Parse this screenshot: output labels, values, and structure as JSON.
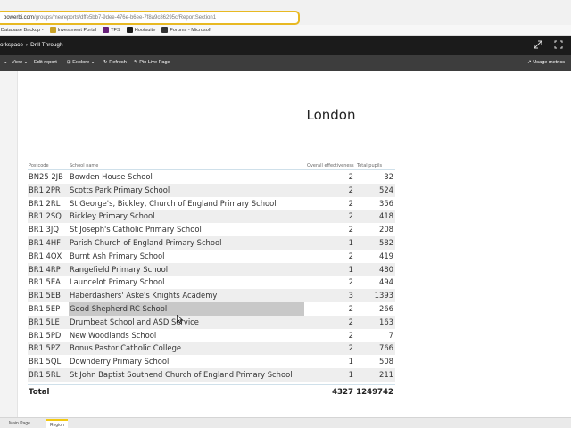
{
  "browser": {
    "url_host": "powerbi.com",
    "url_path": "/groups/me/reports/dffe5bb7-9dee-476e-b6ee-7f8a9c86295c/ReportSection1",
    "bookmarks": [
      {
        "label": "Database Backup -",
        "icon": "database-icon",
        "color": "#3b78d8"
      },
      {
        "label": "Investment Portal",
        "icon": "portal-icon",
        "color": "#c9a227"
      },
      {
        "label": "TFS",
        "icon": "tfs-icon",
        "color": "#68217a"
      },
      {
        "label": "Hootsuite",
        "icon": "hootsuite-icon",
        "color": "#1a1a1a"
      },
      {
        "label": "Forums - Microsoft",
        "icon": "forums-icon",
        "color": "#333333"
      }
    ]
  },
  "header": {
    "workspace": "orkspace",
    "breadcrumb_sep": "›",
    "page": "Drill Through"
  },
  "toolbar": {
    "view": "View ⌄",
    "edit_report": "Edit report",
    "explore": "Explore ⌄",
    "refresh": "Refresh",
    "pin_live": "Pin Live Page",
    "usage": "Usage metrics"
  },
  "report": {
    "title": "London",
    "columns": {
      "postcode": "Postcode",
      "school": "School name",
      "effectiveness": "Overall effectiveness",
      "pupils": "Total pupils"
    },
    "rows": [
      {
        "postcode": "BN25 2JB",
        "school": "Bowden House School",
        "eff": "2",
        "pupils": "32"
      },
      {
        "postcode": "BR1 2PR",
        "school": "Scotts Park Primary School",
        "eff": "2",
        "pupils": "524"
      },
      {
        "postcode": "BR1 2RL",
        "school": "St George's, Bickley, Church of England Primary School",
        "eff": "2",
        "pupils": "356"
      },
      {
        "postcode": "BR1 2SQ",
        "school": "Bickley Primary School",
        "eff": "2",
        "pupils": "418"
      },
      {
        "postcode": "BR1 3JQ",
        "school": "St Joseph's Catholic Primary School",
        "eff": "2",
        "pupils": "208"
      },
      {
        "postcode": "BR1 4HF",
        "school": "Parish Church of England Primary School",
        "eff": "1",
        "pupils": "582"
      },
      {
        "postcode": "BR1 4QX",
        "school": "Burnt Ash Primary School",
        "eff": "2",
        "pupils": "419"
      },
      {
        "postcode": "BR1 4RP",
        "school": "Rangefield Primary School",
        "eff": "1",
        "pupils": "480"
      },
      {
        "postcode": "BR1 5EA",
        "school": "Launcelot Primary School",
        "eff": "2",
        "pupils": "494"
      },
      {
        "postcode": "BR1 5EB",
        "school": "Haberdashers' Aske's Knights Academy",
        "eff": "3",
        "pupils": "1393"
      },
      {
        "postcode": "BR1 5EP",
        "school": "Good Shepherd RC School",
        "eff": "2",
        "pupils": "266"
      },
      {
        "postcode": "BR1 5LE",
        "school": "Drumbeat School and ASD Service",
        "eff": "2",
        "pupils": "163"
      },
      {
        "postcode": "BR1 5PD",
        "school": "New Woodlands School",
        "eff": "2",
        "pupils": "7"
      },
      {
        "postcode": "BR1 5PZ",
        "school": "Bonus Pastor Catholic College",
        "eff": "2",
        "pupils": "766"
      },
      {
        "postcode": "BR1 5QL",
        "school": "Downderry Primary School",
        "eff": "1",
        "pupils": "508"
      },
      {
        "postcode": "BR1 5RL",
        "school": "St John Baptist Southend Church of England Primary School",
        "eff": "1",
        "pupils": "211"
      }
    ],
    "total": {
      "label": "Total",
      "eff": "4327",
      "pupils": "1249742"
    }
  },
  "tabs": [
    {
      "label": "Main Page",
      "active": false
    },
    {
      "label": "Region",
      "active": true
    }
  ]
}
